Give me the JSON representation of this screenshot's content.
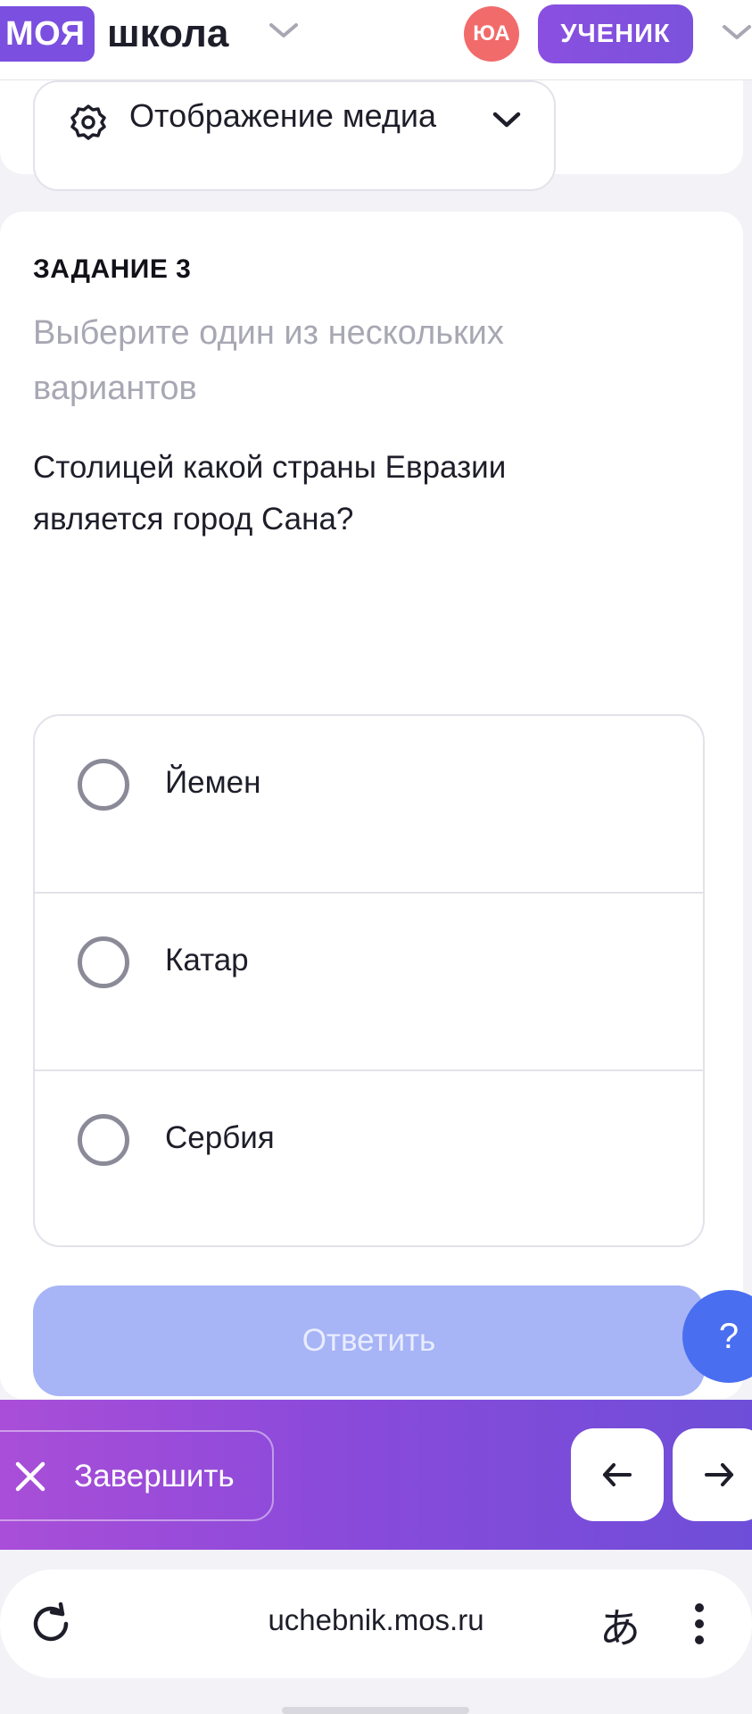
{
  "header": {
    "logo_pill": "МОЯ",
    "logo_word": "школа",
    "avatar_initials": "ЮА",
    "role_label": "УЧЕНИК"
  },
  "media": {
    "label": "Отображение медиа",
    "icon": "gear-icon"
  },
  "task": {
    "title": "ЗАДАНИЕ 3",
    "hint": "Выберите один из нескольких вариантов",
    "question": "Столицей какой страны Евразии является город Сана?",
    "options": [
      {
        "label": "Йемен",
        "selected": false
      },
      {
        "label": "Катар",
        "selected": false
      },
      {
        "label": "Сербия",
        "selected": false
      }
    ],
    "answer_button": "Ответить"
  },
  "help_button": "?",
  "bottom_bar": {
    "finish_label": "Завершить",
    "prev_icon": "arrow-left-icon",
    "next_icon": "arrow-right-icon"
  },
  "browser": {
    "url": "uchebnik.mos.ru",
    "translate_glyph": "あ"
  },
  "colors": {
    "brand_purple": "#7b4fe0",
    "avatar_red": "#f26b6b",
    "answer_disabled": "#a7b4f6",
    "help_blue": "#4a6ef0"
  }
}
